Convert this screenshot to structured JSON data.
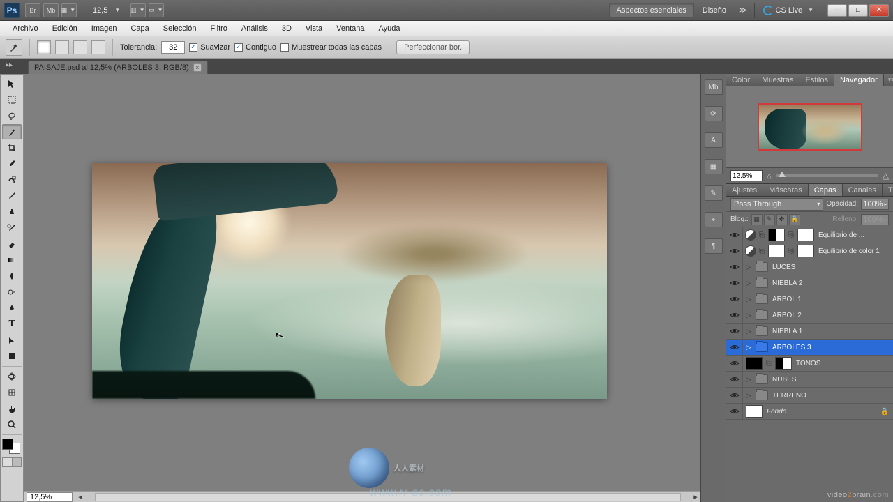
{
  "top": {
    "logo": "Ps",
    "br": "Br",
    "mb": "Mb",
    "zoom": "12,5",
    "workspace_active": "Aspectos esenciales",
    "workspace_next": "Diseño",
    "cslive": "CS Live"
  },
  "menu": {
    "items": [
      "Archivo",
      "Edición",
      "Imagen",
      "Capa",
      "Selección",
      "Filtro",
      "Análisis",
      "3D",
      "Vista",
      "Ventana",
      "Ayuda"
    ]
  },
  "options": {
    "tolerance_label": "Tolerancia:",
    "tolerance_value": "32",
    "suavizar": "Suavizar",
    "contiguo": "Contiguo",
    "muestrear": "Muestrear todas las capas",
    "perfeccionar": "Perfeccionar bor."
  },
  "doctab": {
    "title": "PAISAJE.psd al 12,5% (ÁRBOLES 3, RGB/8)"
  },
  "statusbar": {
    "zoom": "12,5%"
  },
  "nav_panel": {
    "tabs": [
      "Color",
      "Muestras",
      "Estilos",
      "Navegador"
    ],
    "zoom": "12.5%"
  },
  "layers_panel": {
    "tabs": [
      "Ajustes",
      "Máscaras",
      "Capas",
      "Canales",
      "Trazad"
    ],
    "blend_mode": "Pass Through",
    "opacity_label": "Opacidad:",
    "opacity_value": "100%",
    "lock_label": "Bloq.:",
    "fill_label": "Relleno:",
    "fill_value": "100%",
    "layers": [
      {
        "type": "adjust",
        "name": "Equilibrio de ..."
      },
      {
        "type": "adjust",
        "name": "Equilibrio de color 1"
      },
      {
        "type": "group",
        "name": "LUCES"
      },
      {
        "type": "group",
        "name": "NIEBLA 2"
      },
      {
        "type": "group",
        "name": "ÁRBOL 1"
      },
      {
        "type": "group",
        "name": "ÁRBOL 2"
      },
      {
        "type": "group",
        "name": "NIEBLA 1"
      },
      {
        "type": "group",
        "name": "ÁRBOLES 3",
        "selected": true
      },
      {
        "type": "tonos",
        "name": "TONOS"
      },
      {
        "type": "group",
        "name": "NUBES"
      },
      {
        "type": "group",
        "name": "TERRENO"
      },
      {
        "type": "bg",
        "name": "Fondo",
        "locked": true
      }
    ]
  },
  "watermark": {
    "cn": "人人素材",
    "url": "www.rr-sc.com",
    "brand1": "video",
    "brand2": "2",
    "brand3": "brain",
    "brand4": ".com"
  }
}
